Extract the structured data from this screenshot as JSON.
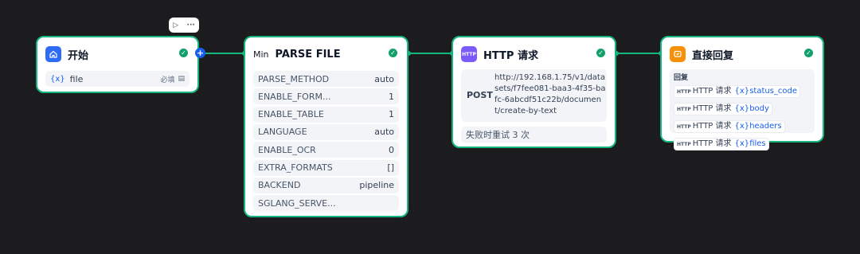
{
  "toolbar": {
    "run_icon": "play-icon",
    "more_icon": "more-icon"
  },
  "start": {
    "title": "开始",
    "var_prefix": "{x}",
    "var_name": "file",
    "var_note": "必填"
  },
  "parse": {
    "prefix": "Min",
    "title": "PARSE FILE",
    "rows": [
      {
        "key": "PARSE_METHOD",
        "value": "auto"
      },
      {
        "key": "ENABLE_FORM...",
        "value": "1"
      },
      {
        "key": "ENABLE_TABLE",
        "value": "1"
      },
      {
        "key": "LANGUAGE",
        "value": "auto"
      },
      {
        "key": "ENABLE_OCR",
        "value": "0"
      },
      {
        "key": "EXTRA_FORMATS",
        "value": "[]"
      },
      {
        "key": "BACKEND",
        "value": "pipeline"
      },
      {
        "key": "SGLANG_SERVE...",
        "value": ""
      }
    ]
  },
  "http": {
    "icon_text": "HTTP",
    "title": "HTTP 请求",
    "method": "POST",
    "url": "http://192.168.1.75/v1/datasets/f7fee081-baa3-4f35-bafc-6abcdf51c22b/document/create-by-text",
    "url_lines": [
      "http://192.168.1.75/v1/data",
      "sets/f7fee081-baa3-4f35-ba",
      "fc-6abcdf51c22b/documen",
      "t/create-by-text"
    ],
    "retry": "失败时重试 3 次"
  },
  "reply": {
    "title": "直接回复",
    "label": "回复",
    "items": [
      {
        "tag": "HTTP",
        "source": "HTTP 请求",
        "prefix": "{x}",
        "var": "status_code"
      },
      {
        "tag": "HTTP",
        "source": "HTTP 请求",
        "prefix": "{x}",
        "var": "body"
      },
      {
        "tag": "HTTP",
        "source": "HTTP 请求",
        "prefix": "{x}",
        "var": "headers"
      },
      {
        "tag": "HTTP",
        "source": "HTTP 请求",
        "prefix": "{x}",
        "var": "files"
      }
    ]
  },
  "colors": {
    "edge": "#15b77e",
    "start_icon": "#2e6bf6",
    "http_icon": "#7a5af8",
    "reply_icon": "#f79009"
  }
}
